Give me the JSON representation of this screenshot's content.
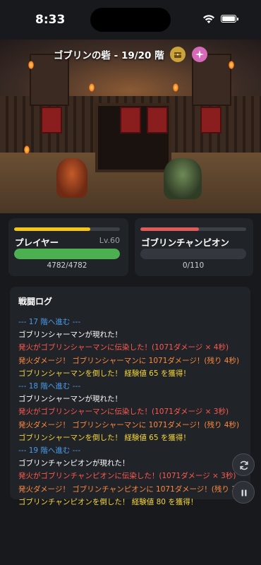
{
  "status_bar": {
    "time": "8:33"
  },
  "arena": {
    "title": "ゴブリンの砦 - 19/20 階",
    "chest_icon": "treasure-chest-icon",
    "sparkle_icon": "sparkle-icon"
  },
  "player": {
    "name": "プレイヤー",
    "level": "Lv.60",
    "hp_text": "4782/4782",
    "hp_fraction": 1.0,
    "exp_fraction": 0.72,
    "exp_color": "#f5c518",
    "hp_color": "#4caf50"
  },
  "enemy": {
    "name": "ゴブリンチャンピオン",
    "hp_text": "0/110",
    "hp_fraction": 0.0,
    "top_fraction": 0.55,
    "top_color": "#e05a5a"
  },
  "log": {
    "title": "戦闘ログ",
    "colors": {
      "blue": "#4a9be8",
      "white": "#ffffff",
      "red": "#ff5a4e",
      "orange": "#ff8a3d",
      "yellow": "#f5d53a"
    },
    "lines": [
      {
        "text": "--- 17 階へ進む ---",
        "color": "blue"
      },
      {
        "text": "ゴブリンシャーマンが現れた！",
        "color": "white"
      },
      {
        "text": "発火がゴブリンシャーマンに伝染した！(1071ダメージ × 4秒)",
        "color": "red"
      },
      {
        "text": "発火ダメージ！ ゴブリンシャーマンに 1071ダメージ！(残り 4秒)",
        "color": "orange"
      },
      {
        "text": "ゴブリンシャーマンを倒した！ 経験値 65 を獲得！",
        "color": "yellow"
      },
      {
        "text": "--- 18 階へ進む ---",
        "color": "blue"
      },
      {
        "text": "ゴブリンシャーマンが現れた！",
        "color": "white"
      },
      {
        "text": "発火がゴブリンシャーマンに伝染した！(1071ダメージ × 3秒)",
        "color": "red"
      },
      {
        "text": "発火ダメージ！ ゴブリンシャーマンに 1071ダメージ！(残り 4秒)",
        "color": "orange"
      },
      {
        "text": "ゴブリンシャーマンを倒した！ 経験値 65 を獲得！",
        "color": "yellow"
      },
      {
        "text": "--- 19 階へ進む ---",
        "color": "blue"
      },
      {
        "text": "ゴブリンチャンピオンが現れた！",
        "color": "white"
      },
      {
        "text": "発火がゴブリンチャンピオンに伝染した！(1071ダメージ × 3秒)",
        "color": "red"
      },
      {
        "text": "発火ダメージ！ ゴブリンチャンピオンに 1071ダメージ！(残り 3秒)",
        "color": "orange"
      },
      {
        "text": "ゴブリンチャンピオンを倒した！ 経験値 80 を獲得！",
        "color": "yellow"
      }
    ]
  },
  "controls": {
    "refresh_icon": "refresh-icon",
    "pause_icon": "pause-icon"
  }
}
